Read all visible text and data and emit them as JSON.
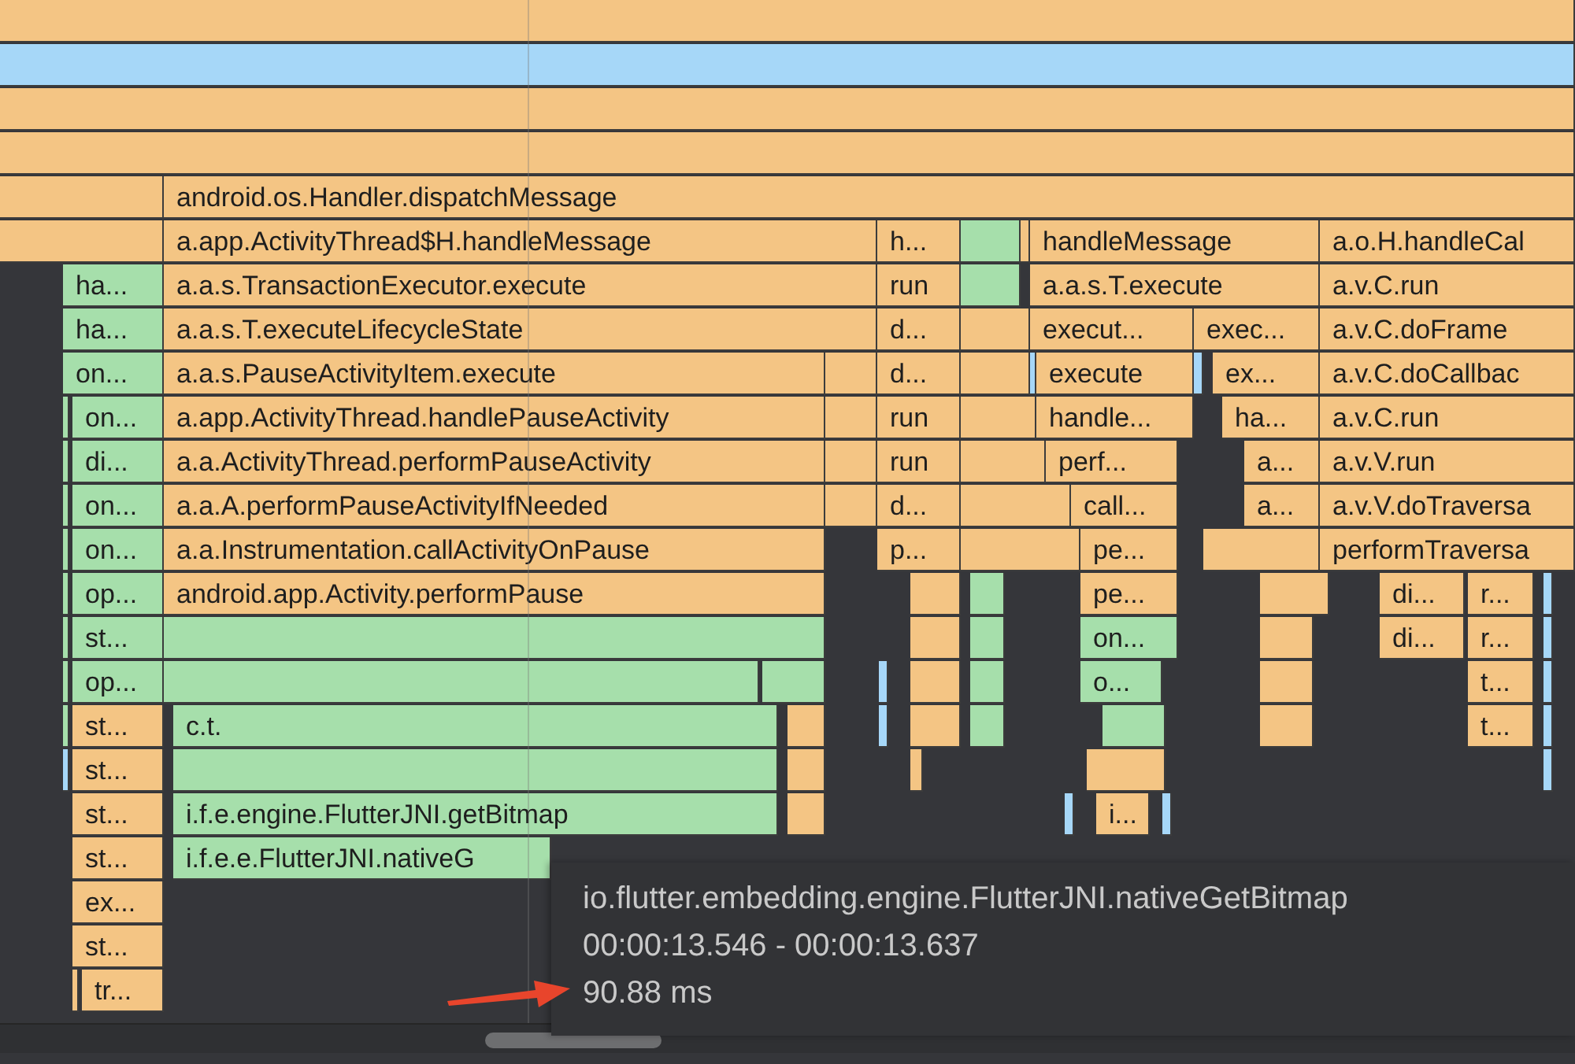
{
  "rows": [
    [
      {
        "kind": "system"
      }
    ],
    [
      {
        "kind": "native"
      }
    ],
    [
      {
        "kind": "system"
      }
    ],
    [
      {
        "kind": "system"
      }
    ],
    [
      {
        "kind": "system"
      },
      {
        "label": "android.os.Handler.dispatchMessage",
        "kind": "system"
      }
    ],
    [
      {
        "kind": "system"
      },
      {
        "label": "a.app.ActivityThread$H.handleMessage",
        "kind": "system"
      },
      {
        "label": "h...",
        "kind": "system"
      },
      {
        "kind": "user"
      },
      {
        "kind": "system"
      },
      {
        "label": "handleMessage",
        "kind": "system"
      },
      {
        "label": "a.o.H.handleCal",
        "kind": "system"
      }
    ],
    [
      {
        "label": "ha...",
        "kind": "user"
      },
      {
        "label": "a.a.s.TransactionExecutor.execute",
        "kind": "system"
      },
      {
        "label": "run",
        "kind": "system"
      },
      {
        "kind": "user"
      },
      {
        "label": "a.a.s.T.execute",
        "kind": "system"
      },
      {
        "label": "a.v.C.run",
        "kind": "system"
      }
    ],
    [
      {
        "label": "ha...",
        "kind": "user"
      },
      {
        "label": "a.a.s.T.executeLifecycleState",
        "kind": "system"
      },
      {
        "label": "d...",
        "kind": "system"
      },
      {
        "kind": "system"
      },
      {
        "label": "execut...",
        "kind": "system"
      },
      {
        "label": "exec...",
        "kind": "system"
      },
      {
        "label": "a.v.C.doFrame",
        "kind": "system"
      }
    ],
    [
      {
        "label": "on...",
        "kind": "user"
      },
      {
        "label": "a.a.s.PauseActivityItem.execute",
        "kind": "system"
      },
      {
        "kind": "system"
      },
      {
        "label": "d...",
        "kind": "system"
      },
      {
        "kind": "system"
      },
      {
        "kind": "native"
      },
      {
        "label": "execute",
        "kind": "system"
      },
      {
        "kind": "native"
      },
      {
        "label": "ex...",
        "kind": "system"
      },
      {
        "label": "a.v.C.doCallbac",
        "kind": "system"
      }
    ],
    [
      {
        "kind": "user"
      },
      {
        "label": "on...",
        "kind": "user"
      },
      {
        "label": "a.app.ActivityThread.handlePauseActivity",
        "kind": "system"
      },
      {
        "kind": "system"
      },
      {
        "label": "run",
        "kind": "system"
      },
      {
        "kind": "system"
      },
      {
        "label": "handle...",
        "kind": "system"
      },
      {
        "label": "ha...",
        "kind": "system"
      },
      {
        "label": "a.v.C.run",
        "kind": "system"
      }
    ],
    [
      {
        "kind": "user"
      },
      {
        "label": "di...",
        "kind": "user"
      },
      {
        "label": "a.a.ActivityThread.performPauseActivity",
        "kind": "system"
      },
      {
        "kind": "system"
      },
      {
        "label": "run",
        "kind": "system"
      },
      {
        "kind": "system"
      },
      {
        "label": "perf...",
        "kind": "system"
      },
      {
        "label": "a...",
        "kind": "system"
      },
      {
        "label": "a.v.V.run",
        "kind": "system"
      }
    ],
    [
      {
        "kind": "user"
      },
      {
        "label": "on...",
        "kind": "user"
      },
      {
        "label": "a.a.A.performPauseActivityIfNeeded",
        "kind": "system"
      },
      {
        "kind": "system"
      },
      {
        "label": "d...",
        "kind": "system"
      },
      {
        "kind": "system"
      },
      {
        "label": "call...",
        "kind": "system"
      },
      {
        "label": "a...",
        "kind": "system"
      },
      {
        "label": "a.v.V.doTraversa",
        "kind": "system"
      }
    ],
    [
      {
        "kind": "user"
      },
      {
        "label": "on...",
        "kind": "user"
      },
      {
        "label": "a.a.Instrumentation.callActivityOnPause",
        "kind": "system"
      },
      {
        "label": "p...",
        "kind": "system"
      },
      {
        "kind": "system"
      },
      {
        "label": "pe...",
        "kind": "system"
      },
      {
        "kind": "system"
      },
      {
        "label": "performTraversa",
        "kind": "system"
      }
    ],
    [
      {
        "kind": "user"
      },
      {
        "label": "op...",
        "kind": "user"
      },
      {
        "label": "android.app.Activity.performPause",
        "kind": "system"
      },
      {
        "kind": "system"
      },
      {
        "kind": "user"
      },
      {
        "label": "pe...",
        "kind": "system"
      },
      {
        "kind": "system"
      },
      {
        "label": "di...",
        "kind": "system"
      },
      {
        "label": "r...",
        "kind": "system"
      },
      {
        "kind": "native"
      }
    ],
    [
      {
        "kind": "user"
      },
      {
        "label": "st...",
        "kind": "user"
      },
      {
        "kind": "user"
      },
      {
        "kind": "system"
      },
      {
        "kind": "user"
      },
      {
        "label": "on...",
        "kind": "user"
      },
      {
        "kind": "system"
      },
      {
        "label": "di...",
        "kind": "system"
      },
      {
        "label": "r...",
        "kind": "system"
      },
      {
        "kind": "native"
      }
    ],
    [
      {
        "kind": "user"
      },
      {
        "label": "op...",
        "kind": "user"
      },
      {
        "kind": "user"
      },
      {
        "kind": "user"
      },
      {
        "kind": "native"
      },
      {
        "kind": "system"
      },
      {
        "kind": "user"
      },
      {
        "label": "o...",
        "kind": "user"
      },
      {
        "kind": "system"
      },
      {
        "label": "t...",
        "kind": "system"
      },
      {
        "kind": "native"
      }
    ],
    [
      {
        "kind": "user"
      },
      {
        "label": "st...",
        "kind": "system"
      },
      {
        "label": "c.t.",
        "kind": "user"
      },
      {
        "kind": "system"
      },
      {
        "kind": "native"
      },
      {
        "kind": "system"
      },
      {
        "kind": "user"
      },
      {
        "kind": "user"
      },
      {
        "kind": "system"
      },
      {
        "label": "t...",
        "kind": "system"
      },
      {
        "kind": "native"
      }
    ],
    [
      {
        "kind": "native"
      },
      {
        "label": "st...",
        "kind": "system"
      },
      {
        "kind": "user"
      },
      {
        "kind": "system"
      },
      {
        "kind": "system"
      },
      {
        "kind": "system"
      },
      {
        "kind": "native"
      }
    ],
    [
      {
        "label": "st...",
        "kind": "system"
      },
      {
        "label": "i.f.e.engine.FlutterJNI.getBitmap",
        "kind": "user"
      },
      {
        "kind": "system"
      },
      {
        "kind": "native"
      },
      {
        "label": "i...",
        "kind": "system"
      },
      {
        "kind": "native"
      }
    ],
    [
      {
        "label": "st...",
        "kind": "system"
      },
      {
        "label": "i.f.e.e.FlutterJNI.nativeG",
        "kind": "user"
      }
    ],
    [
      {
        "label": "ex...",
        "kind": "system"
      }
    ],
    [
      {
        "label": "st...",
        "kind": "system"
      }
    ],
    [
      {
        "kind": "system"
      },
      {
        "label": "tr...",
        "kind": "system"
      }
    ]
  ],
  "tooltip": {
    "method": "io.flutter.embedding.engine.FlutterJNI.nativeGetBitmap",
    "time_range": "00:00:13.546 - 00:00:13.637",
    "duration": "90.88 ms"
  }
}
